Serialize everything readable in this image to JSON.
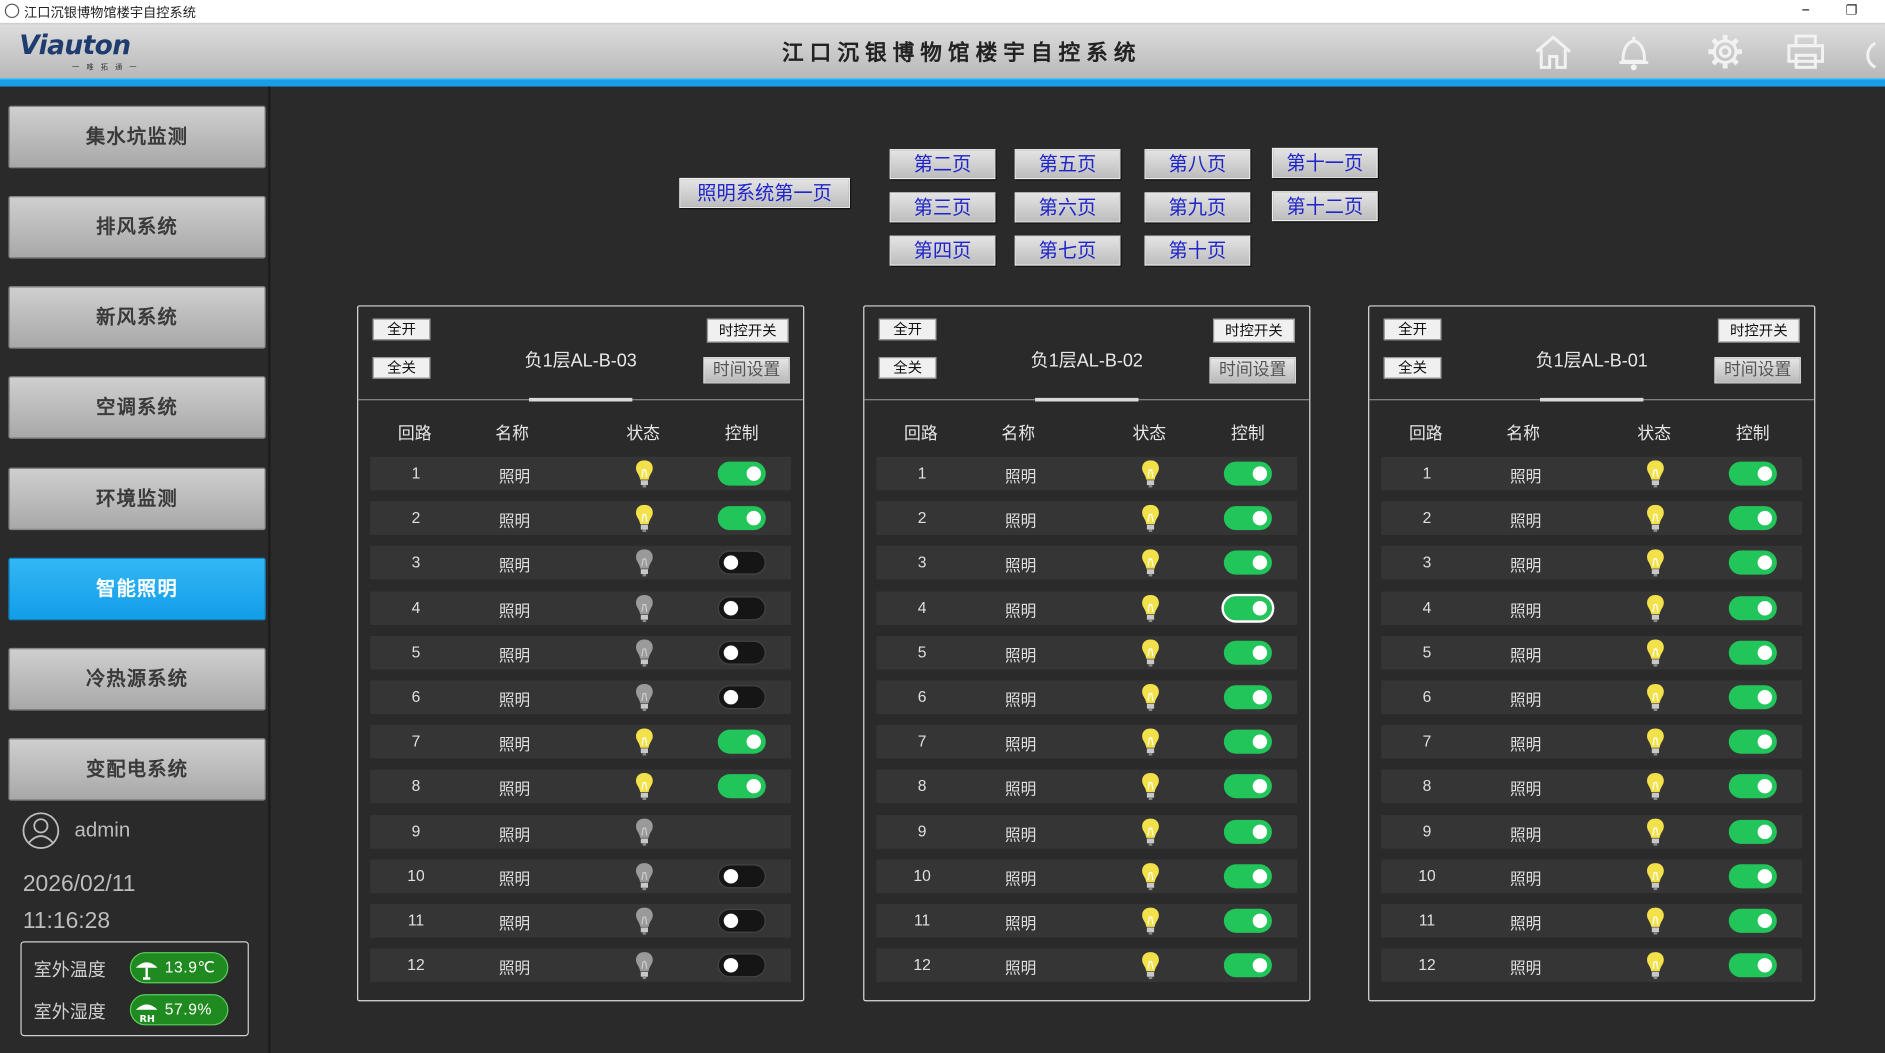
{
  "window": {
    "title": "江口沉银博物馆楼宇自控系统",
    "minimize": "–",
    "maximize": "❐"
  },
  "header": {
    "logo": "Viauton",
    "logo_sub": "一 唯 拓 通 一",
    "title": "江口沉银博物馆楼宇自控系统",
    "icons": [
      "home-icon",
      "bell-icon",
      "gear-icon",
      "printer-icon",
      "power-icon"
    ]
  },
  "sidebar": {
    "items": [
      {
        "label": "集水坑监测",
        "active": false
      },
      {
        "label": "排风系统",
        "active": false
      },
      {
        "label": "新风系统",
        "active": false
      },
      {
        "label": "空调系统",
        "active": false
      },
      {
        "label": "环境监测",
        "active": false
      },
      {
        "label": "智能照明",
        "active": true
      },
      {
        "label": "冷热源系统",
        "active": false
      },
      {
        "label": "变配电系统",
        "active": false
      }
    ],
    "user": "admin",
    "date": "2026/02/11",
    "time": "11:16:28",
    "env": [
      {
        "label": "室外温度",
        "value": "13.9℃",
        "icon": "thermometer-icon"
      },
      {
        "label": "室外湿度",
        "value": "57.9%",
        "icon": "humidity-icon"
      }
    ]
  },
  "pages": {
    "first": "照明系统第一页",
    "grid": [
      "第二页",
      "第三页",
      "第四页",
      "第五页",
      "第六页",
      "第七页",
      "第八页",
      "第九页",
      "第十页",
      "第十一页",
      "第十二页"
    ]
  },
  "panels": [
    {
      "title": "负1层AL-B-03",
      "all_on": "全开",
      "all_off": "全关",
      "timer": "时控开关",
      "time_set": "时间设置",
      "headers": {
        "circuit": "回路",
        "name": "名称",
        "status": "状态",
        "control": "控制"
      },
      "rows": [
        {
          "n": "1",
          "name": "照明",
          "lit": true,
          "toggle": "on"
        },
        {
          "n": "2",
          "name": "照明",
          "lit": true,
          "toggle": "on"
        },
        {
          "n": "3",
          "name": "照明",
          "lit": false,
          "toggle": "off"
        },
        {
          "n": "4",
          "name": "照明",
          "lit": false,
          "toggle": "off"
        },
        {
          "n": "5",
          "name": "照明",
          "lit": false,
          "toggle": "off"
        },
        {
          "n": "6",
          "name": "照明",
          "lit": false,
          "toggle": "off"
        },
        {
          "n": "7",
          "name": "照明",
          "lit": true,
          "toggle": "on"
        },
        {
          "n": "8",
          "name": "照明",
          "lit": true,
          "toggle": "on"
        },
        {
          "n": "9",
          "name": "照明",
          "lit": false,
          "toggle": "none"
        },
        {
          "n": "10",
          "name": "照明",
          "lit": false,
          "toggle": "off"
        },
        {
          "n": "11",
          "name": "照明",
          "lit": false,
          "toggle": "off"
        },
        {
          "n": "12",
          "name": "照明",
          "lit": false,
          "toggle": "off"
        }
      ]
    },
    {
      "title": "负1层AL-B-02",
      "all_on": "全开",
      "all_off": "全关",
      "timer": "时控开关",
      "time_set": "时间设置",
      "headers": {
        "circuit": "回路",
        "name": "名称",
        "status": "状态",
        "control": "控制"
      },
      "rows": [
        {
          "n": "1",
          "name": "照明",
          "lit": true,
          "toggle": "on"
        },
        {
          "n": "2",
          "name": "照明",
          "lit": true,
          "toggle": "on"
        },
        {
          "n": "3",
          "name": "照明",
          "lit": true,
          "toggle": "on"
        },
        {
          "n": "4",
          "name": "照明",
          "lit": true,
          "toggle": "on",
          "focused": true
        },
        {
          "n": "5",
          "name": "照明",
          "lit": true,
          "toggle": "on"
        },
        {
          "n": "6",
          "name": "照明",
          "lit": true,
          "toggle": "on"
        },
        {
          "n": "7",
          "name": "照明",
          "lit": true,
          "toggle": "on"
        },
        {
          "n": "8",
          "name": "照明",
          "lit": true,
          "toggle": "on"
        },
        {
          "n": "9",
          "name": "照明",
          "lit": true,
          "toggle": "on"
        },
        {
          "n": "10",
          "name": "照明",
          "lit": true,
          "toggle": "on"
        },
        {
          "n": "11",
          "name": "照明",
          "lit": true,
          "toggle": "on"
        },
        {
          "n": "12",
          "name": "照明",
          "lit": true,
          "toggle": "on"
        }
      ]
    },
    {
      "title": "负1层AL-B-01",
      "all_on": "全开",
      "all_off": "全关",
      "timer": "时控开关",
      "time_set": "时间设置",
      "headers": {
        "circuit": "回路",
        "name": "名称",
        "status": "状态",
        "control": "控制"
      },
      "rows": [
        {
          "n": "1",
          "name": "照明",
          "lit": true,
          "toggle": "on"
        },
        {
          "n": "2",
          "name": "照明",
          "lit": true,
          "toggle": "on"
        },
        {
          "n": "3",
          "name": "照明",
          "lit": true,
          "toggle": "on"
        },
        {
          "n": "4",
          "name": "照明",
          "lit": true,
          "toggle": "on"
        },
        {
          "n": "5",
          "name": "照明",
          "lit": true,
          "toggle": "on"
        },
        {
          "n": "6",
          "name": "照明",
          "lit": true,
          "toggle": "on"
        },
        {
          "n": "7",
          "name": "照明",
          "lit": true,
          "toggle": "on"
        },
        {
          "n": "8",
          "name": "照明",
          "lit": true,
          "toggle": "on"
        },
        {
          "n": "9",
          "name": "照明",
          "lit": true,
          "toggle": "on"
        },
        {
          "n": "10",
          "name": "照明",
          "lit": true,
          "toggle": "on"
        },
        {
          "n": "11",
          "name": "照明",
          "lit": true,
          "toggle": "on"
        },
        {
          "n": "12",
          "name": "照明",
          "lit": true,
          "toggle": "on"
        }
      ]
    }
  ],
  "colors": {
    "accent": "#1a9ee8",
    "toggle_on": "#22c55a",
    "bulb_on": "#f2e14a",
    "bulb_off": "#9a9a9a",
    "page_text": "#1f25c9"
  }
}
